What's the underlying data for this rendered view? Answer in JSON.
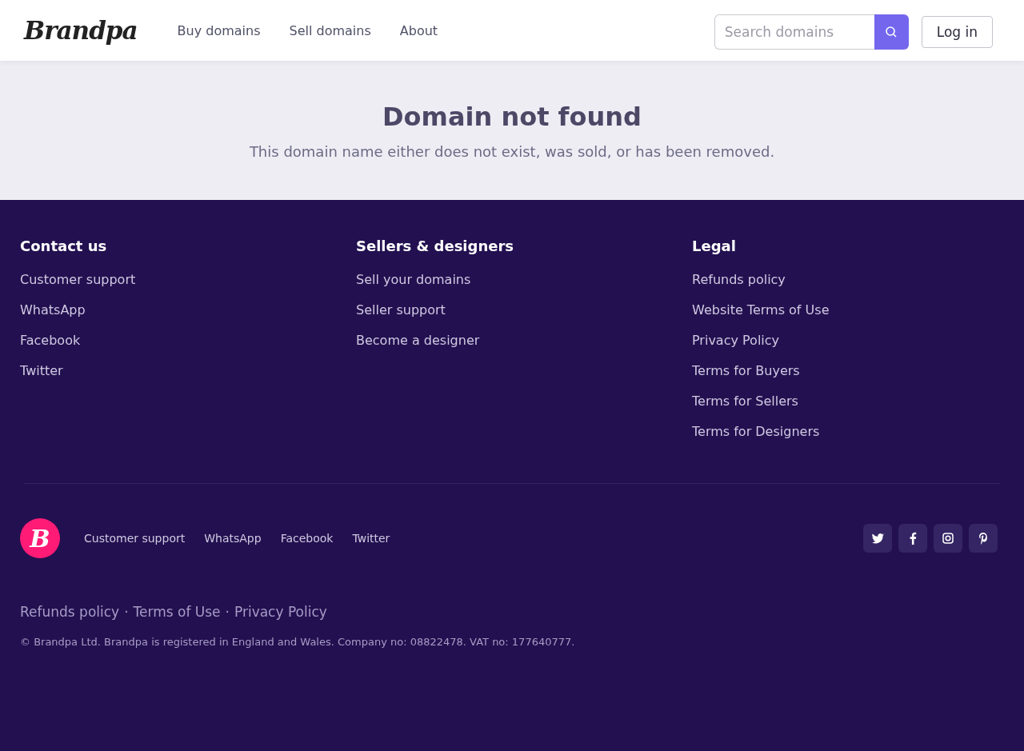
{
  "header": {
    "logo": "Brandpa",
    "nav": [
      "Buy domains",
      "Sell domains",
      "About"
    ],
    "search": {
      "placeholder": "Search domains"
    },
    "login": "Log in"
  },
  "hero": {
    "title": "Domain not found",
    "text": "This domain name either does not exist, was sold, or has been removed."
  },
  "footer": {
    "columns": [
      {
        "title": "Contact us",
        "links": [
          "Customer support",
          "WhatsApp",
          "Facebook",
          "Twitter"
        ]
      },
      {
        "title": "Sellers & designers",
        "links": [
          "Sell your domains",
          "Seller support",
          "Become a designer"
        ]
      },
      {
        "title": "Legal",
        "links": [
          "Refunds policy",
          "Website Terms of Use",
          "Privacy Policy",
          "Terms for Buyers",
          "Terms for Sellers",
          "Terms for Designers"
        ]
      }
    ],
    "logo_mark": "B",
    "bottom_links": [
      "Customer support",
      "WhatsApp",
      "Facebook",
      "Twitter"
    ],
    "social": [
      {
        "kind": "twitter"
      },
      {
        "kind": "facebook"
      },
      {
        "kind": "instagram"
      },
      {
        "kind": "pinterest"
      }
    ],
    "legal_links": [
      "Refunds policy",
      "Terms of Use",
      "Privacy Policy"
    ],
    "separator": "·",
    "copyright": "© Brandpa Ltd. Brandpa is registered in England and Wales. Company no: 08822478. VAT no: 177640777."
  }
}
